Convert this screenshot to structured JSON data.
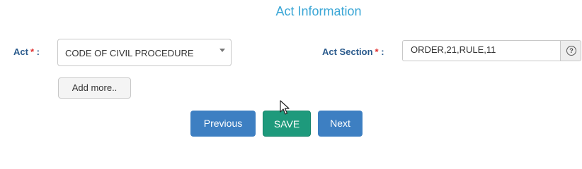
{
  "section": {
    "title": "Act Information"
  },
  "form": {
    "act_label": "Act",
    "act_required": "*",
    "act_colon": " :",
    "act_selected": "CODE OF CIVIL PROCEDURE",
    "act_section_label": "Act Section",
    "act_section_required": "*",
    "act_section_colon": " :",
    "act_section_value": "ORDER,21,RULE,11",
    "help_glyph": "?"
  },
  "buttons": {
    "add_more": "Add more..",
    "previous": "Previous",
    "save": "SAVE",
    "next": "Next"
  },
  "colors": {
    "title": "#3aa6d6",
    "label": "#2a5a8c",
    "required": "#e03030",
    "primary_button": "#3d7fc2",
    "save_button": "#1e9a7c"
  },
  "icons": {
    "dropdown": "chevron-down-icon",
    "help": "question-circle-icon",
    "cursor": "mouse-pointer-icon"
  }
}
